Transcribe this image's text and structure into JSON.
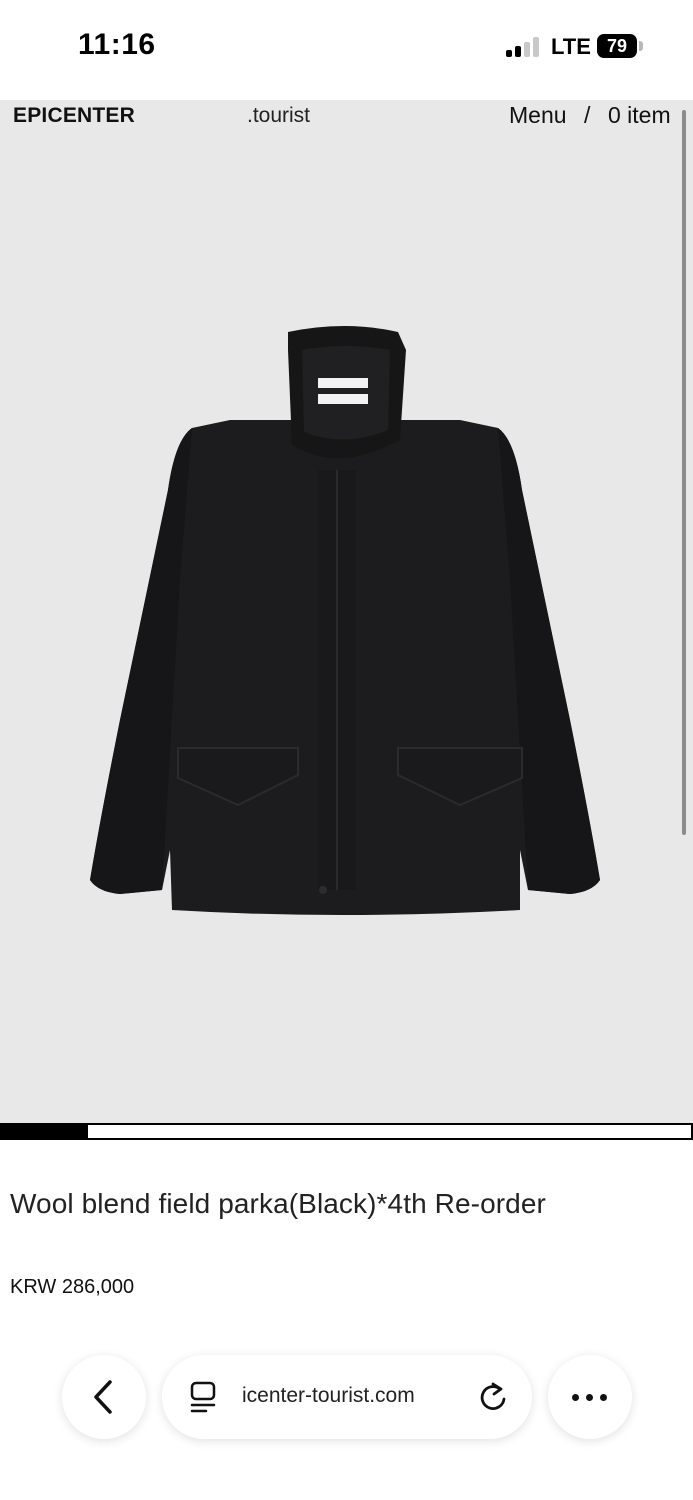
{
  "status_bar": {
    "time": "11:16",
    "network": "LTE",
    "battery": "79"
  },
  "site_header": {
    "brand": "EPICENTER",
    "sub_brand": ".tourist",
    "menu_label": "Menu",
    "separator": "/",
    "cart_label": "0 item"
  },
  "gallery": {
    "image_subject": "black wool field parka",
    "progress": 0.125
  },
  "product": {
    "title": "Wool blend field parka(Black)*4th Re-order",
    "price": "KRW 286,000"
  },
  "browser_bar": {
    "url": "icenter-tourist.com",
    "back_icon": "chevron-left-icon",
    "page_icon": "page-menu-icon",
    "reload_icon": "reload-icon",
    "more_icon": "more-dots-icon"
  },
  "colors": {
    "hero_background": "#e8e8e8",
    "jacket": "#1c1c1e",
    "progress_fill": "#000000"
  }
}
